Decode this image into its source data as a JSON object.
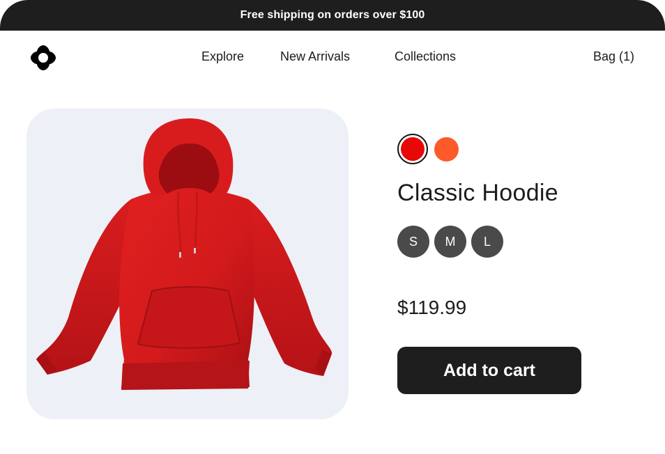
{
  "promo": {
    "text": "Free shipping on orders over $100"
  },
  "nav": {
    "logo_icon": "four-lobe-star-logo-icon",
    "links": [
      {
        "label": "Explore"
      },
      {
        "label": "New Arrivals"
      },
      {
        "label": "Collections"
      }
    ],
    "bag_label": "Bag (1)"
  },
  "product": {
    "image_icon": "red-hoodie-photo",
    "title": "Classic Hoodie",
    "colors": [
      {
        "hex": "#e80808",
        "selected": true
      },
      {
        "hex": "#fd5a2a",
        "selected": false
      }
    ],
    "sizes": [
      "S",
      "M",
      "L"
    ],
    "price": "$119.99",
    "add_to_cart_label": "Add to cart"
  },
  "theme": {
    "dark": "#1e1e1e",
    "image_bg": "#eef0f7",
    "size_chip": "#4a4a4a"
  }
}
